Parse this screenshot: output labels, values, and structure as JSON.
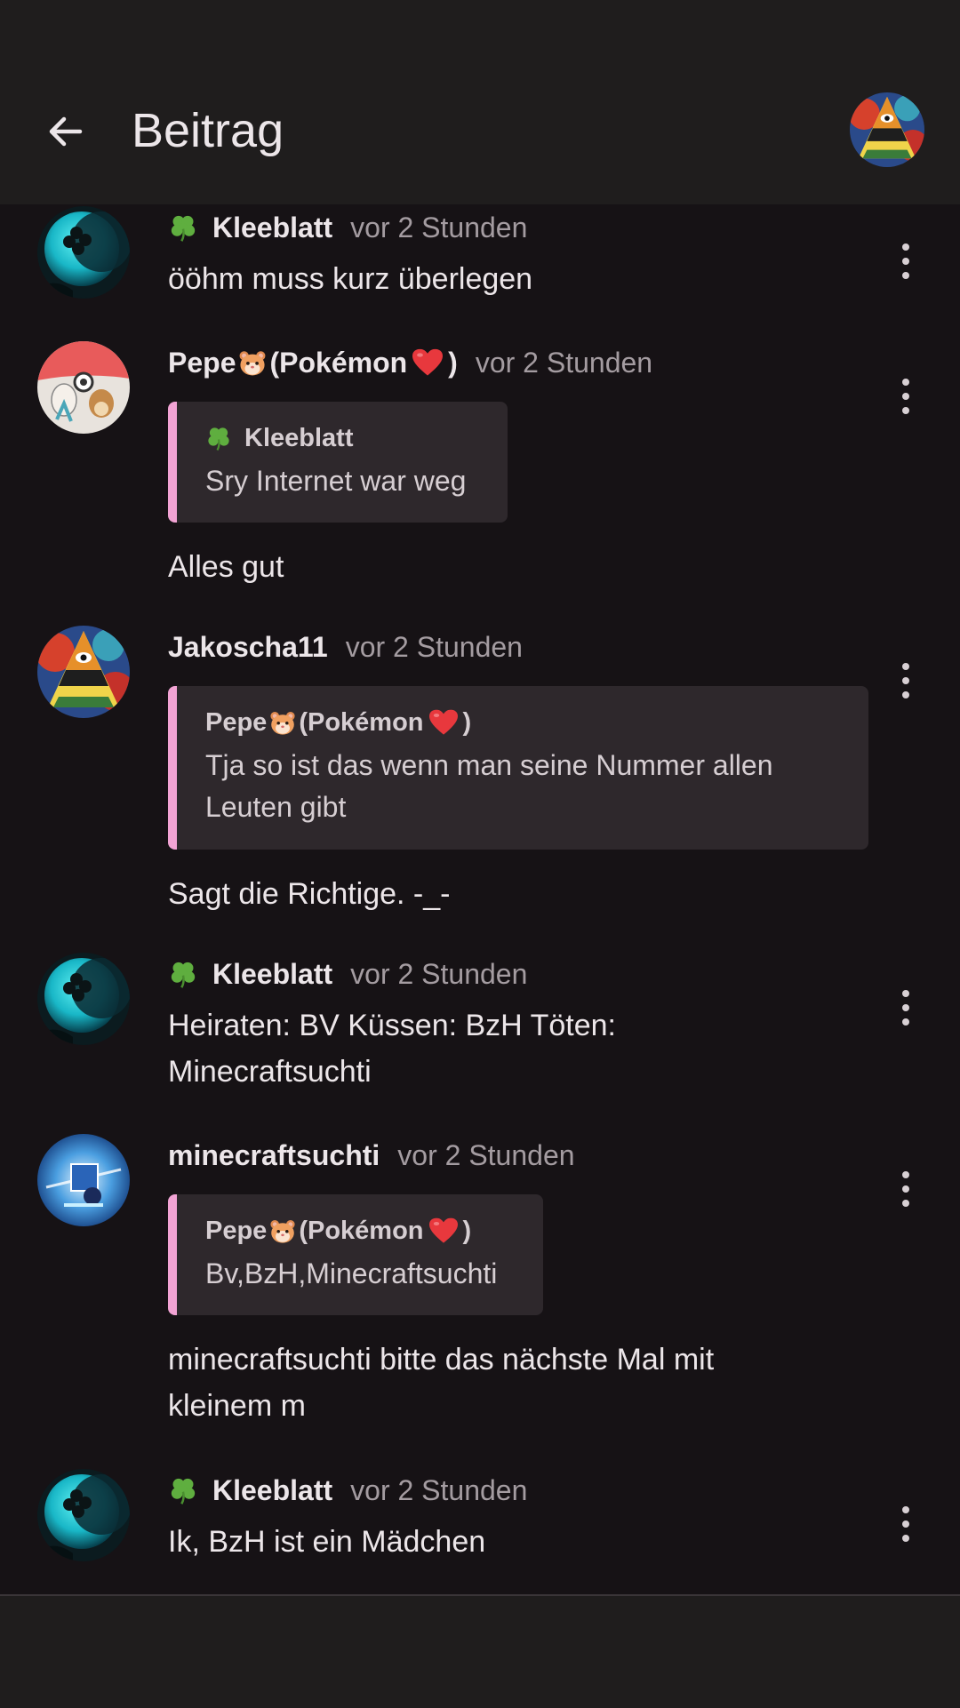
{
  "header": {
    "title": "Beitrag",
    "back_icon": "arrow-left-icon",
    "avatar_icon": "user-avatar"
  },
  "comments": [
    {
      "author": "Kleeblatt",
      "author_icon": "four-leaf-clover-icon",
      "time": "vor 2 Stunden",
      "text": "ööhm muss kurz überlegen"
    },
    {
      "author": "Pepe",
      "author_icon": "hamster-emoji",
      "author_suffix": "(Pokémon",
      "author_suffix_icon": "red-heart-emoji",
      "author_end": ")",
      "time": "vor 2 Stunden",
      "quote": {
        "author": "Kleeblatt",
        "author_icon": "four-leaf-clover-icon",
        "text": "Sry Internet war weg"
      },
      "text": "Alles gut"
    },
    {
      "author": "Jakoscha11",
      "time": "vor 2 Stunden",
      "quote": {
        "author": "Pepe",
        "author_suffix": "(Pokémon",
        "author_end": ")",
        "text": "Tja so ist das wenn man seine Nummer allen Leuten gibt"
      },
      "text": "Sagt die Richtige. -_-"
    },
    {
      "author": "Kleeblatt",
      "author_icon": "four-leaf-clover-icon",
      "time": "vor 2 Stunden",
      "text": "Heiraten: BV Küssen: BzH Töten: Minecraftsuchti"
    },
    {
      "author": "minecraftsuchti",
      "time": "vor 2 Stunden",
      "quote": {
        "author": "Pepe",
        "author_suffix": "(Pokémon",
        "author_end": ")",
        "text": "Bv,BzH,Minecraftsuchti"
      },
      "text": "minecraftsuchti bitte das nächste Mal mit kleinem m"
    },
    {
      "author": "Kleeblatt",
      "author_icon": "four-leaf-clover-icon",
      "time": "vor 2 Stunden",
      "text": "Ik, BzH ist ein Mädchen"
    }
  ],
  "colors": {
    "background": "#161215",
    "app_bar": "#1f1d1d",
    "quote_background": "#2e282c",
    "quote_accent": "#f2a3d4",
    "secondary_text": "#a49ca1"
  }
}
